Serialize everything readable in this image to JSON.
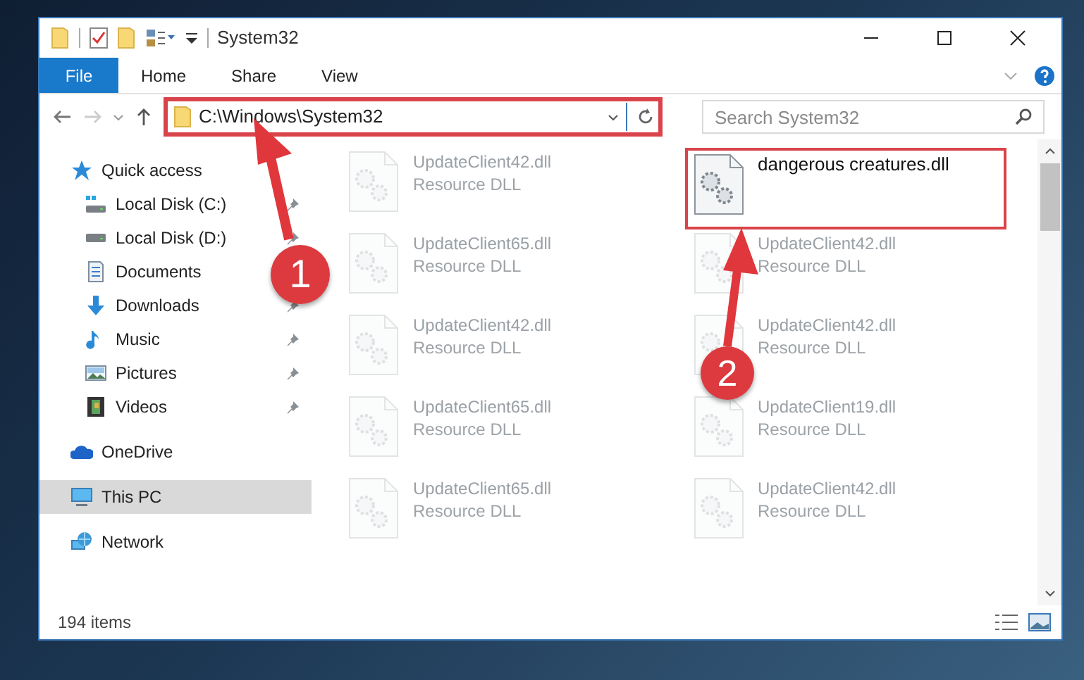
{
  "window": {
    "title": "System32"
  },
  "ribbon_tabs": [
    {
      "label": "File",
      "selected": true
    },
    {
      "label": "Home",
      "selected": false
    },
    {
      "label": "Share",
      "selected": false
    },
    {
      "label": "View",
      "selected": false
    }
  ],
  "address": {
    "path": "C:\\Windows\\System32",
    "highlighted": true
  },
  "search": {
    "placeholder": "Search System32"
  },
  "sidebar": {
    "items": [
      {
        "label": "Quick access",
        "kind": "star",
        "selected": false,
        "children": [
          {
            "label": "Local Disk (C:)",
            "kind": "system-drive",
            "pinned": true
          },
          {
            "label": "Local Disk (D:)",
            "kind": "drive",
            "pinned": true
          },
          {
            "label": "Documents",
            "kind": "documents"
          },
          {
            "label": "Downloads",
            "kind": "downloads",
            "pinned": true
          },
          {
            "label": "Music",
            "kind": "music",
            "pinned": true
          },
          {
            "label": "Pictures",
            "kind": "pictures",
            "pinned": true
          },
          {
            "label": "Videos",
            "kind": "videos",
            "pinned": true
          }
        ]
      },
      {
        "label": "OneDrive",
        "kind": "cloud",
        "selected": false
      },
      {
        "label": "This PC",
        "kind": "pc",
        "selected": true
      },
      {
        "label": "Network",
        "kind": "network",
        "selected": false
      }
    ]
  },
  "files": [
    {
      "name": "UpdateClient42.dll",
      "type": "Resource DLL",
      "faded": true,
      "highlighted": false
    },
    {
      "name": "dangerous creatures.dll",
      "faded": false,
      "highlighted": true
    },
    {
      "name": "UpdateClient65.dll",
      "type": "Resource DLL",
      "faded": true,
      "highlighted": false
    },
    {
      "name": "UpdateClient42.dll",
      "type": "Resource DLL",
      "faded": true,
      "highlighted": false
    },
    {
      "name": "UpdateClient42.dll",
      "type": "Resource DLL",
      "faded": true,
      "highlighted": false
    },
    {
      "name": "UpdateClient42.dll",
      "type": "Resource DLL",
      "faded": true,
      "highlighted": false
    },
    {
      "name": "UpdateClient65.dll",
      "type": "Resource DLL",
      "faded": true,
      "highlighted": false
    },
    {
      "name": "UpdateClient19.dll",
      "type": "Resource DLL",
      "faded": true,
      "highlighted": false
    },
    {
      "name": "UpdateClient65.dll",
      "type": "Resource DLL",
      "faded": true,
      "highlighted": false
    },
    {
      "name": "UpdateClient42.dll",
      "type": "Resource DLL",
      "faded": true,
      "highlighted": false
    }
  ],
  "status_bar": {
    "count": "194 items"
  },
  "annotations": [
    {
      "label": "1"
    },
    {
      "label": "2"
    }
  ]
}
